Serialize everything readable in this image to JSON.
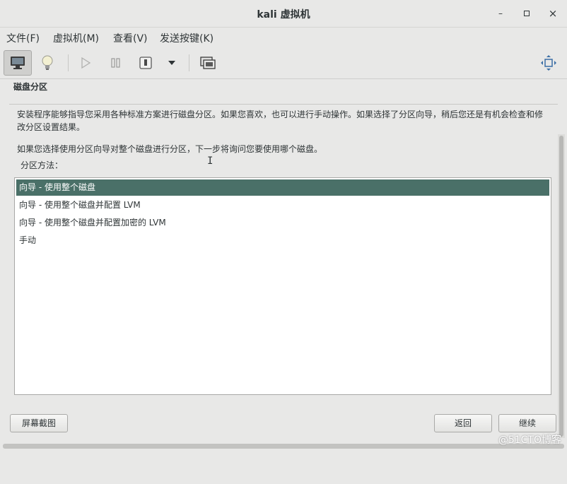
{
  "window": {
    "title": "kali 虚拟机",
    "minimize_glyph": "–",
    "maximize_glyph": "▫",
    "close_glyph": "×"
  },
  "menu": {
    "items": [
      {
        "label": "文件(F)"
      },
      {
        "label": "虚拟机(M)"
      },
      {
        "label": "查看(V)"
      },
      {
        "label": "发送按键(K)"
      }
    ]
  },
  "toolbar": {
    "icons": [
      "console-icon",
      "lightbulb-icon",
      "play-icon",
      "pause-icon",
      "power-icon",
      "dropdown-arrow-icon",
      "snapshot-icon",
      "fullscreen-icon"
    ]
  },
  "installer": {
    "section_title": "磁盘分区",
    "description": "安装程序能够指导您采用各种标准方案进行磁盘分区。如果您喜欢，也可以进行手动操作。如果选择了分区向导，稍后您还是有机会检查和修改分区设置结果。",
    "description2": "如果您选择使用分区向导对整个磁盘进行分区，下一步将询问您要使用哪个磁盘。",
    "method_label": "分区方法：",
    "cursor_glyph": "I",
    "options": [
      {
        "label": "向导 - 使用整个磁盘",
        "selected": true
      },
      {
        "label": "向导 - 使用整个磁盘并配置 LVM",
        "selected": false
      },
      {
        "label": "向导 - 使用整个磁盘并配置加密的 LVM",
        "selected": false
      },
      {
        "label": "手动",
        "selected": false
      }
    ]
  },
  "buttons": {
    "screenshot": "屏幕截图",
    "back": "返回",
    "continue": "继续"
  },
  "watermark": "@51CTO博客",
  "colors": {
    "selection": "#4a7068",
    "background": "#e8e8e7"
  }
}
